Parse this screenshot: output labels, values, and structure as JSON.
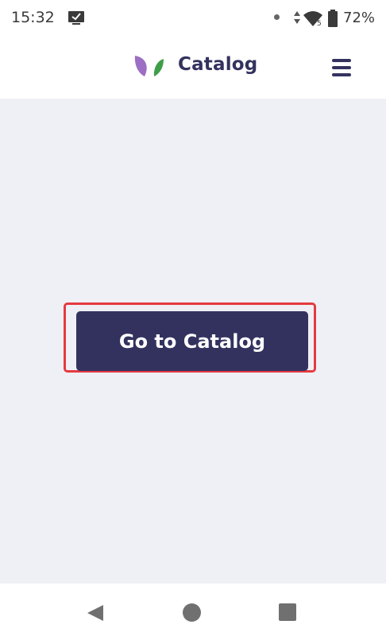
{
  "status_bar": {
    "time": "15:32",
    "battery_percent": "72%",
    "icons": [
      "screenshot-check-icon",
      "dot-icon",
      "data-arrows-icon",
      "wifi-icon",
      "battery-icon"
    ]
  },
  "header": {
    "title": "Catalog",
    "logo_icon": "leaf-logo-icon",
    "menu_icon": "hamburger-menu-icon",
    "logo_colors": {
      "left_leaf": "#9c6fc4",
      "right_leaf": "#3f9e48"
    }
  },
  "main": {
    "primary_button_label": "Go to Catalog",
    "button_color": "#33325f",
    "highlight_color": "#e53a40",
    "background_color": "#eff0f5"
  },
  "navigation_bar": {
    "icons": [
      "back-icon",
      "home-icon",
      "recents-icon"
    ]
  }
}
